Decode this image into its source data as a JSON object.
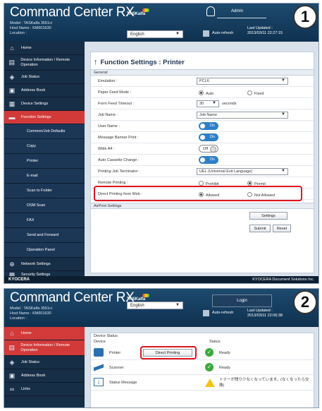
{
  "brand": {
    "name": "TASKalfa",
    "product_title": "Command Center RX"
  },
  "device": {
    "model_label": "Model : TASKalfa 3551ci",
    "host_label": "Host Name : KM601630",
    "location_label": "Location :"
  },
  "language": {
    "selected": "English"
  },
  "auto_refresh_label": "Auto-refresh",
  "step_badges": {
    "one": "1",
    "two": "2"
  },
  "screen1": {
    "user_name": "Admin",
    "last_updated_label": "Last Updated :",
    "last_updated_value": "2013/03/11 22:27:15",
    "sidebar": [
      {
        "label": "Home",
        "icon": "home-icon"
      },
      {
        "label": "Device Information / Remote Operation",
        "icon": "device-info-icon"
      },
      {
        "label": "Job Status",
        "icon": "job-status-icon"
      },
      {
        "label": "Address Book",
        "icon": "address-book-icon"
      },
      {
        "label": "Device Settings",
        "icon": "device-settings-icon"
      },
      {
        "label": "Function Settings",
        "icon": "function-settings-icon"
      }
    ],
    "sub_menu": [
      "Common/Job Defaults",
      "Copy",
      "Printer",
      "E-mail",
      "Scan to Folder",
      "DSM Scan",
      "FAX",
      "Send and Forward",
      "Operation Panel"
    ],
    "sidebar_bottom": [
      {
        "label": "Network Settings",
        "icon": "network-icon"
      },
      {
        "label": "Security Settings",
        "icon": "security-icon"
      }
    ],
    "page_title": "Function Settings : Printer",
    "section_general": "General",
    "fields": {
      "emulation": {
        "label": "Emulation :",
        "value": "PCL6"
      },
      "paper_feed": {
        "label": "Paper Feed Mode :",
        "options": [
          "Auto",
          "Fixed"
        ],
        "selected": "Auto"
      },
      "form_feed": {
        "label": "Form Feed Timeout :",
        "value": "30",
        "unit": "seconds"
      },
      "job_name": {
        "label": "Job Name :",
        "value": "Job Name"
      },
      "user_name": {
        "label": "User Name :",
        "value": "On"
      },
      "msg_banner": {
        "label": "Message Banner Print :",
        "value": "On"
      },
      "wide_a4": {
        "label": "Wide A4 :",
        "value": "Off"
      },
      "auto_cassette": {
        "label": "Auto Cassette Change :",
        "value": "On"
      },
      "job_terminator": {
        "label": "Printing Job Terminator :",
        "value": "UEL (Universal Exit Language)"
      },
      "remote_printing": {
        "label": "Remote Printing :",
        "options": [
          "Prohibit",
          "Permit"
        ],
        "selected": "Permit"
      },
      "direct_printing": {
        "label": "Direct Printing from Web :",
        "options": [
          "Allowed",
          "Not Allowed"
        ],
        "selected": "Allowed"
      }
    },
    "section_airprint": "AirPrint Settings",
    "settings_btn": "Settings",
    "submit_btn": "Submit",
    "reset_btn": "Reset",
    "footer_logo": "KYOCERA",
    "footer_copy": "KYOCERA Document Solutions Inc."
  },
  "screen2": {
    "login_btn": "Login",
    "last_updated_label": "Last Updated :",
    "last_updated_value": "2013/03/11 22:06:38",
    "sidebar": [
      {
        "label": "Home",
        "icon": "home-icon"
      },
      {
        "label": "Device Information / Remote Operation",
        "icon": "device-info-icon"
      },
      {
        "label": "Job Status",
        "icon": "job-status-icon"
      },
      {
        "label": "Address Book",
        "icon": "address-book-icon"
      },
      {
        "label": "Links",
        "icon": "links-icon"
      }
    ],
    "device_status_title": "Device Status",
    "col_device": "Device",
    "col_status": "Status",
    "rows": [
      {
        "name": "Printer",
        "status": "Ready",
        "button": "Direct Printing"
      },
      {
        "name": "Scanner",
        "status": "Ready"
      },
      {
        "name": "Status Message",
        "status": "トナーが残り少なくなっています。(なくなったら交換)"
      }
    ]
  }
}
